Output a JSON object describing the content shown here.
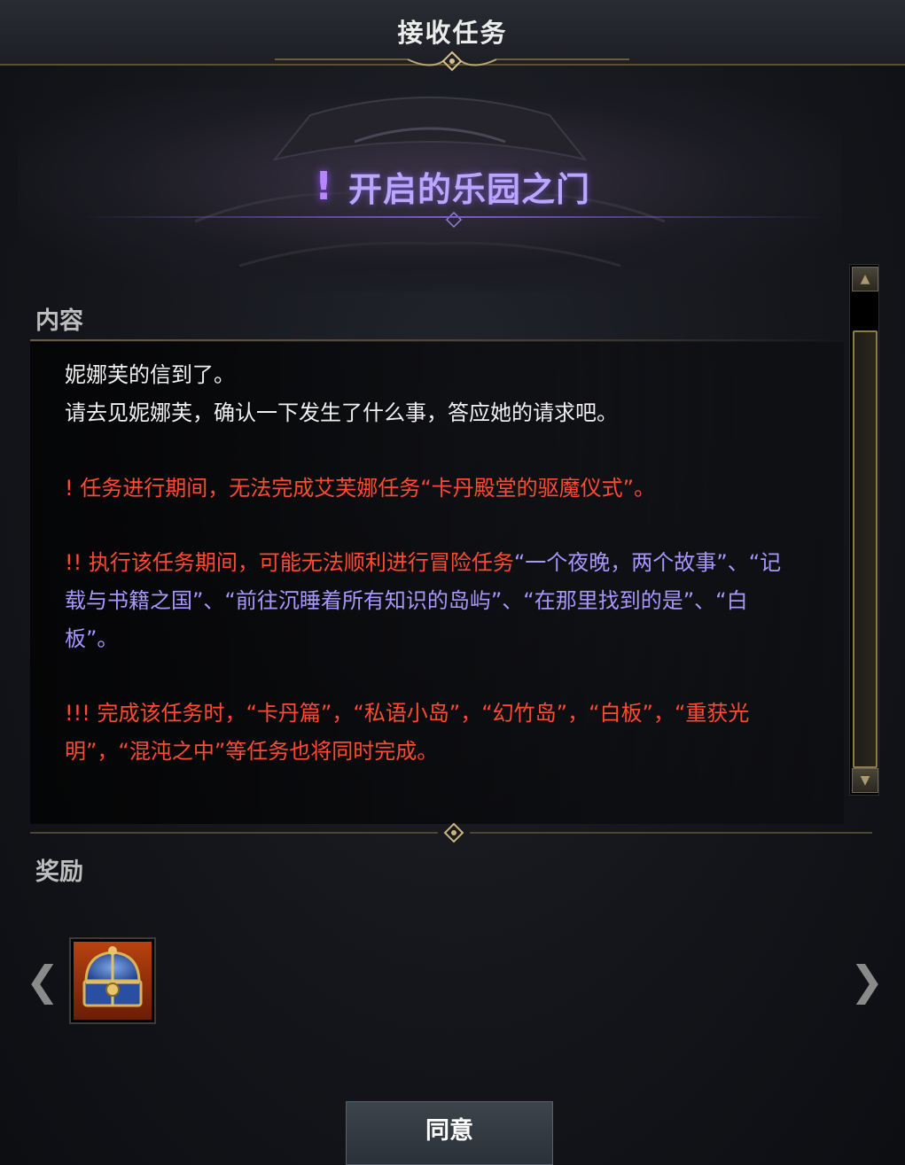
{
  "window": {
    "title": "接收任务"
  },
  "quest": {
    "mark": "!",
    "title": "开启的乐园之门"
  },
  "content": {
    "label": "内容",
    "intro_lines": [
      "妮娜芙的信到了。",
      "请去见妮娜芙，确认一下发生了什么事，答应她的请求吧。"
    ],
    "warning1": "! 任务进行期间，无法完成艾芙娜任务“卡丹殿堂的驱魔仪式”。",
    "warning2_prefix": "!! 执行该任务期间，可能无法顺利进行冒险任务",
    "warning2_quests": "“一个夜晚，两个故事”、“记载与书籍之国”、“前往沉睡着所有知识的岛屿”、“在那里找到的是”、“白板”。",
    "warning3": "!!! 完成该任务时，“卡丹篇”，“私语小岛”，“幻竹岛”，“白板”，“重获光明”，“混沌之中”等任务也将同时完成。"
  },
  "reward": {
    "label": "奖励",
    "items": [
      {
        "icon": "treasure-chest-icon"
      }
    ]
  },
  "navigation": {
    "prev_icon": "chevron-left-icon",
    "next_icon": "chevron-right-icon",
    "prev": "❮",
    "next": "❯"
  },
  "scrollbar": {
    "up": "▲",
    "down": "▼"
  },
  "actions": {
    "accept_label": "同意"
  },
  "colors": {
    "warning_red": "#ff4a34",
    "quest_purple": "#a996ff",
    "gold_trim": "#8d7b48",
    "title_purple": "#b9a6ff"
  }
}
